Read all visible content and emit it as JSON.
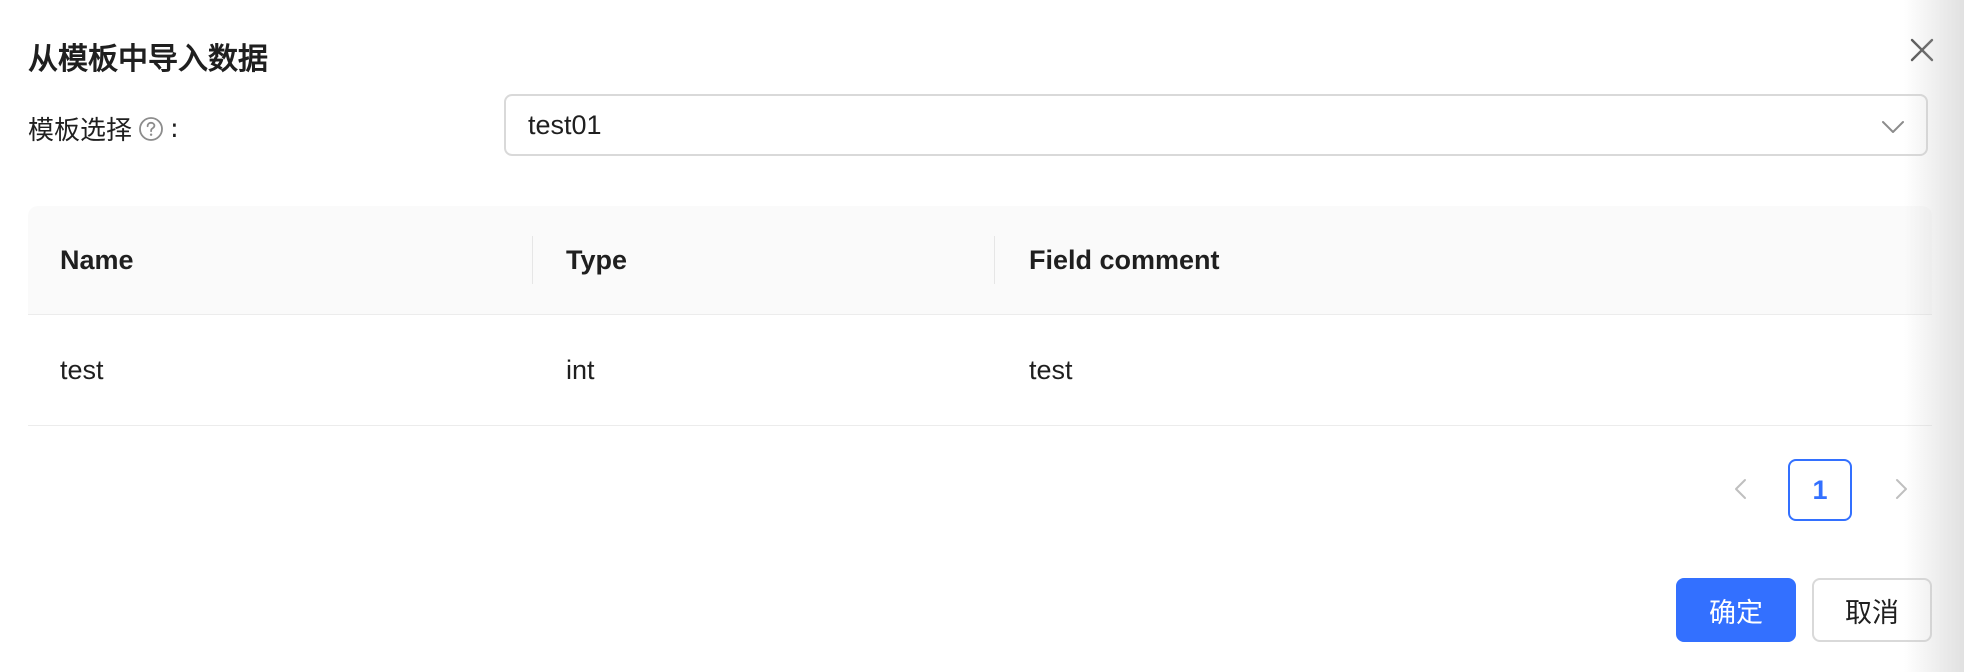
{
  "dialog": {
    "title": "从模板中导入数据",
    "close_icon": "close-icon"
  },
  "form": {
    "template_label": "模板选择",
    "label_colon": ":",
    "help_icon": "question-circle-icon",
    "template_value": "test01",
    "select_icon": "chevron-down-icon"
  },
  "table": {
    "columns": [
      "Name",
      "Type",
      "Field comment"
    ],
    "rows": [
      [
        "test",
        "int",
        "test"
      ]
    ]
  },
  "pagination": {
    "current_page": "1",
    "prev_icon": "chevron-left-icon",
    "next_icon": "chevron-right-icon"
  },
  "footer": {
    "ok_label": "确定",
    "cancel_label": "取消"
  },
  "colors": {
    "primary": "#3370ff",
    "border": "#d9d9d9",
    "header_bg": "#fafafa",
    "text": "#1f1f1f"
  }
}
